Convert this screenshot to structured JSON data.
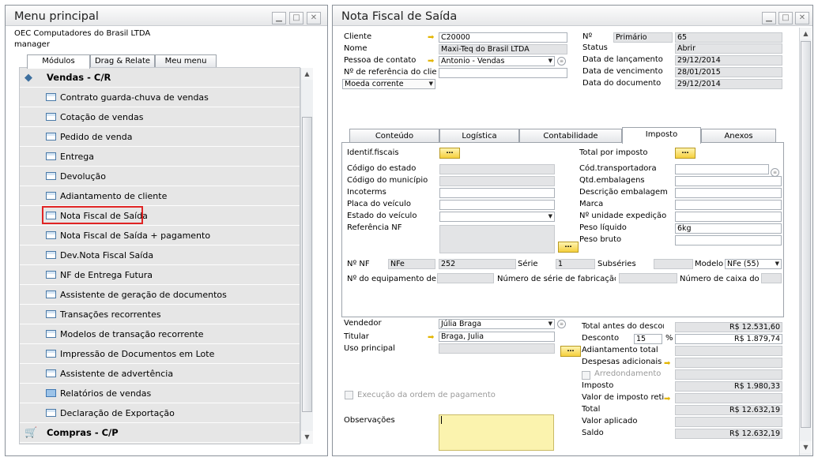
{
  "left_window": {
    "title": "Menu principal",
    "company": "OEC Computadores do Brasil LTDA",
    "user": "manager",
    "tabs": [
      {
        "label": "Módulos"
      },
      {
        "label": "Drag & Relate"
      },
      {
        "label": "Meu menu"
      }
    ],
    "items": [
      {
        "label": "Vendas - C/R",
        "group": true
      },
      {
        "label": "Contrato guarda-chuva de vendas"
      },
      {
        "label": "Cotação de vendas"
      },
      {
        "label": "Pedido de venda"
      },
      {
        "label": "Entrega"
      },
      {
        "label": "Devolução"
      },
      {
        "label": "Adiantamento de cliente"
      },
      {
        "label": "Nota Fiscal de Saída",
        "highlighted": true
      },
      {
        "label": "Nota Fiscal de Saída + pagamento"
      },
      {
        "label": "Dev.Nota Fiscal Saída"
      },
      {
        "label": "NF de Entrega Futura"
      },
      {
        "label": "Assistente de geração de documentos"
      },
      {
        "label": "Transações recorrentes"
      },
      {
        "label": "Modelos de transação recorrente"
      },
      {
        "label": "Impressão de Documentos em Lote"
      },
      {
        "label": "Assistente de advertência"
      },
      {
        "label": "Relatórios de vendas",
        "folder": true
      },
      {
        "label": "Declaração de Exportação"
      },
      {
        "label": "Compras - C/P",
        "group": true
      }
    ]
  },
  "right_window": {
    "title": "Nota Fiscal de Saída",
    "header_left": [
      {
        "label": "Cliente",
        "value": "C20000",
        "arrow": true
      },
      {
        "label": "Nome",
        "value": "Maxi-Teq do Brasil LTDA"
      },
      {
        "label": "Pessoa de contato",
        "value": "Antonio - Vendas",
        "dropdown": true
      },
      {
        "label": "Nº de referência do clie",
        "value": ""
      }
    ],
    "currency_select": "Moeda corrente",
    "header_right": {
      "no_label": "Nº",
      "series": "Primário",
      "number": "65",
      "rows": [
        {
          "label": "Status",
          "value": "Abrir"
        },
        {
          "label": "Data de lançamento",
          "value": "29/12/2014"
        },
        {
          "label": "Data de vencimento",
          "value": "28/01/2015"
        },
        {
          "label": "Data do documento",
          "value": "29/12/2014"
        }
      ]
    },
    "tabs": [
      {
        "label": "Conteúdo"
      },
      {
        "label": "Logística"
      },
      {
        "label": "Contabilidade"
      },
      {
        "label": "Imposto",
        "active": true
      },
      {
        "label": "Anexos"
      }
    ],
    "tax_left": {
      "identif": "Identif.fiscais",
      "rows": [
        "Código do estado",
        "Código do município",
        "Incoterms",
        "Placa do veículo",
        "Estado do veículo",
        "Referência NF"
      ]
    },
    "tax_right": {
      "total": "Total por imposto",
      "rows": [
        {
          "label": "Cód.transportadora",
          "value": ""
        },
        {
          "label": "Qtd.embalagens",
          "value": ""
        },
        {
          "label": "Descrição embalagem",
          "value": ""
        },
        {
          "label": "Marca",
          "value": ""
        },
        {
          "label": "Nº unidade expedição",
          "value": ""
        },
        {
          "label": "Peso líquido",
          "value": "6kg"
        },
        {
          "label": "Peso bruto",
          "value": ""
        }
      ]
    },
    "nf": {
      "no_label": "Nº NF",
      "type": "NFe",
      "number": "252",
      "serie_label": "Série",
      "serie": "1",
      "subseries_label": "Subséries",
      "modelo_label": "Modelo",
      "modelo": "NFe (55)",
      "equip_label": "Nº do equipamento de pc",
      "fab_label": "Número de série de fabricação do",
      "caixa_label": "Número de caixa do pc"
    },
    "bottom_left": {
      "vendedor_label": "Vendedor",
      "vendedor": "Júlia Braga",
      "titular_label": "Titular",
      "titular": "Braga, Julia",
      "uso_label": "Uso principal",
      "execucao": "Execução da ordem de pagamento",
      "obs_label": "Observações"
    },
    "totals": [
      {
        "label": "Total antes do desconto",
        "value": "R$ 12.531,60"
      },
      {
        "label": "Desconto",
        "pct": "15",
        "pct_sign": "%",
        "value": "R$ 1.879,74"
      },
      {
        "label": "Adiantamento total",
        "value": ""
      },
      {
        "label": "Despesas adicionais",
        "value": ""
      },
      {
        "label": "Arredondamento",
        "value": ""
      },
      {
        "label": "Imposto",
        "value": "R$ 1.980,33"
      },
      {
        "label": "Valor de imposto retidc",
        "value": ""
      },
      {
        "label": "Total",
        "value": "R$ 12.632,19"
      },
      {
        "label": "Valor aplicado",
        "value": ""
      },
      {
        "label": "Saldo",
        "value": "R$ 12.632,19"
      }
    ]
  },
  "colors": {
    "highlight_border": "#e02424",
    "yellow_button": "#f5cf3d",
    "field_readonly": "#e3e4e6"
  }
}
